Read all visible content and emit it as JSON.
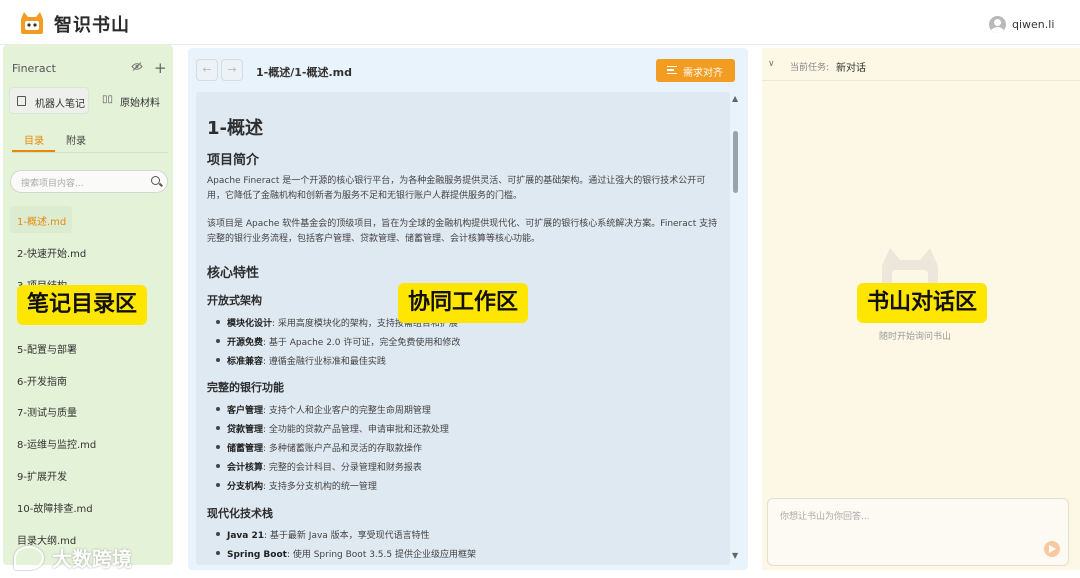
{
  "app": {
    "title": "智识书山",
    "username": "qiwen.li"
  },
  "sidebar": {
    "project": "Fineract",
    "buttons": {
      "robot_notes": "机器人笔记",
      "raw_material": "原始材料"
    },
    "tabs": {
      "toc": "目录",
      "appendix": "附录"
    },
    "search_placeholder": "搜索项目内容...",
    "items": [
      {
        "label": "1-概述.md"
      },
      {
        "label": "2-快速开始.md"
      },
      {
        "label": "3-项目结构"
      },
      {
        "label": "5-配置与部署"
      },
      {
        "label": "6-开发指南"
      },
      {
        "label": "7-测试与质量"
      },
      {
        "label": "8-运维与监控.md"
      },
      {
        "label": "9-扩展开发"
      },
      {
        "label": "10-故障排查.md"
      },
      {
        "label": "目录大纲.md"
      }
    ],
    "overlay_label": "笔记目录区"
  },
  "workspace": {
    "path": "1-概述/1-概述.md",
    "align_button": "需求对齐",
    "overlay_label": "协同工作区",
    "doc": {
      "h1": "1-概述",
      "intro_h2": "项目简介",
      "intro_p1": "Apache Fineract 是一个开源的核心银行平台，为各种金融服务提供灵活、可扩展的基础架构。通过让强大的银行技术公开可用，它降低了金融机构和创新者为服务不足和无银行账户人群提供服务的门槛。",
      "intro_p2": "该项目是 Apache 软件基金会的顶级项目，旨在为全球的金融机构提供现代化、可扩展的银行核心系统解决方案。Fineract 支持完整的银行业务流程，包括客户管理、贷款管理、储蓄管理、会计核算等核心功能。",
      "features_h2": "核心特性",
      "open_h3": "开放式架构",
      "open_items": [
        {
          "b": "模块化设计",
          "t": ": 采用高度模块化的架构，支持按需组合和扩展"
        },
        {
          "b": "开源免费",
          "t": ": 基于 Apache 2.0 许可证，完全免费使用和修改"
        },
        {
          "b": "标准兼容",
          "t": ": 遵循金融行业标准和最佳实践"
        }
      ],
      "bank_h3": "完整的银行功能",
      "bank_items": [
        {
          "b": "客户管理",
          "t": ": 支持个人和企业客户的完整生命周期管理"
        },
        {
          "b": "贷款管理",
          "t": ": 全功能的贷款产品管理、申请审批和还款处理"
        },
        {
          "b": "储蓄管理",
          "t": ": 多种储蓄账户产品和灵活的存取款操作"
        },
        {
          "b": "会计核算",
          "t": ": 完整的会计科目、分录管理和财务报表"
        },
        {
          "b": "分支机构",
          "t": ": 支持多分支机构的统一管理"
        }
      ],
      "tech_h3": "现代化技术栈",
      "tech_items": [
        {
          "b": "Java 21",
          "t": ": 基于最新 Java 版本，享受现代语言特性"
        },
        {
          "b": "Spring Boot",
          "t": ": 使用 Spring Boot 3.5.5 提供企业级应用框架"
        }
      ]
    }
  },
  "chat": {
    "task_label": "当前任务:",
    "task_value": "新对话",
    "hint": "随时开始询问书山",
    "input_placeholder": "你想让书山为你回答...",
    "overlay_label": "书山对话区"
  },
  "watermark": "大数跨境",
  "icons": {
    "logo": "cat-logo-icon",
    "eye": "eye-slash-icon",
    "plus": "plus-icon",
    "robot": "notebook-icon",
    "raw": "books-icon",
    "search": "search-icon",
    "back": "arrow-left-icon",
    "forward": "arrow-right-icon",
    "align": "list-align-icon",
    "chevron": "chevron-down-icon",
    "send": "send-icon",
    "avatar": "user-avatar-icon"
  },
  "colors": {
    "accent": "#e8890e",
    "align_button": "#f29d22",
    "sidebar_bg": "#e4f2d8",
    "workspace_bg": "#e8f3fb",
    "chat_bg": "#fdf8e6",
    "label_yellow": "#ffe600"
  }
}
